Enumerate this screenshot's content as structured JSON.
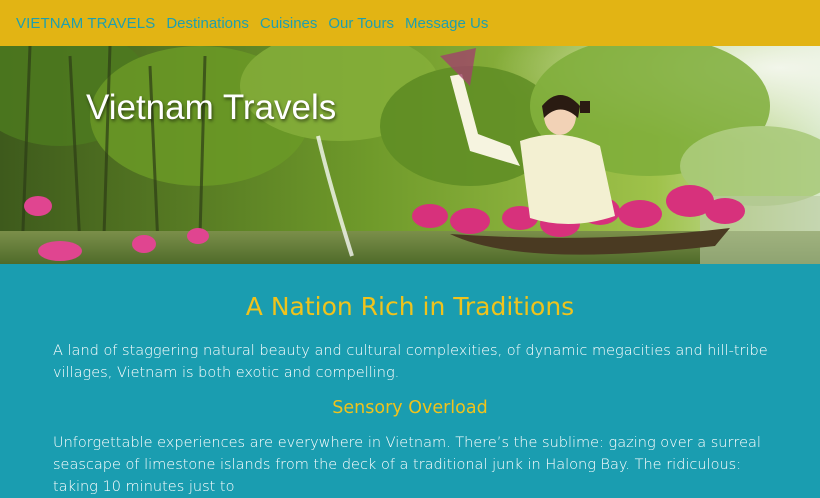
{
  "nav": {
    "brand": "VIETNAM TRAVELS",
    "links": [
      "Destinations",
      "Cuisines",
      "Our Tours",
      "Message Us"
    ]
  },
  "hero": {
    "title": "Vietnam Travels"
  },
  "main": {
    "heading": "A Nation Rich in Traditions",
    "intro": "A land of staggering natural beauty and cultural complexities, of dynamic megacities and hill-tribe villages, Vietnam is both exotic and compelling.",
    "subheading": "Sensory Overload",
    "body": "Unforgettable experiences are everywhere in Vietnam. There’s the sublime: gazing over a surreal seascape of limestone islands from the deck of a traditional junk in Halong Bay. The ridiculous: taking 10 minutes just to"
  },
  "colors": {
    "nav_bg": "#e2b414",
    "nav_link": "#1f9fae",
    "content_bg": "#1a9db0",
    "heading": "#f0c31c",
    "text": "#ffffff"
  }
}
